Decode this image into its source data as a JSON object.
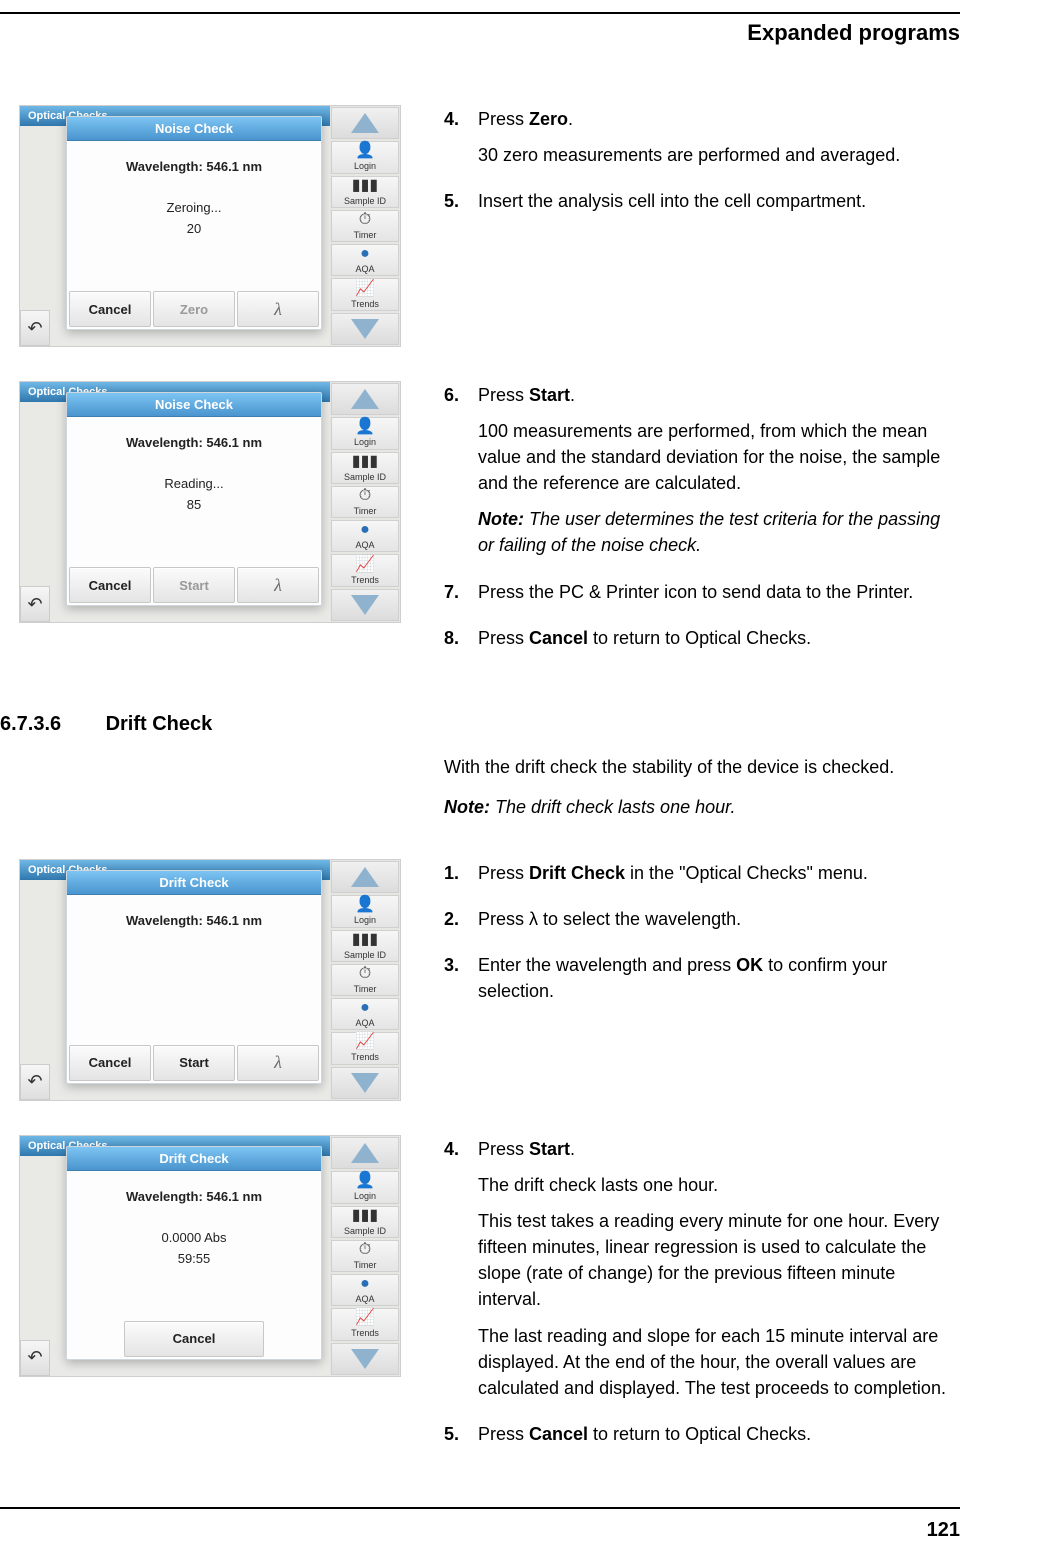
{
  "header": {
    "title": "Expanded programs"
  },
  "footer": {
    "page_number": "121"
  },
  "sidebar": {
    "login": "Login",
    "sample_id": "Sample ID",
    "timer": "Timer",
    "aqa": "AQA",
    "trends": "Trends"
  },
  "screens": {
    "noise_zeroing": {
      "app_header": "Optical Checks",
      "title": "Noise Check",
      "wavelength": "Wavelength: 546.1 nm",
      "status": "Zeroing...",
      "count": "20",
      "btn_cancel": "Cancel",
      "btn_zero": "Zero"
    },
    "noise_reading": {
      "app_header": "Optical Checks",
      "title": "Noise Check",
      "wavelength": "Wavelength: 546.1 nm",
      "status": "Reading...",
      "count": "85",
      "btn_cancel": "Cancel",
      "btn_start": "Start"
    },
    "drift_start": {
      "app_header": "Optical Checks",
      "title": "Drift Check",
      "wavelength": "Wavelength: 546.1 nm",
      "btn_cancel": "Cancel",
      "btn_start": "Start"
    },
    "drift_running": {
      "app_header": "Optical Checks",
      "title": "Drift Check",
      "wavelength": "Wavelength: 546.1 nm",
      "abs": "0.0000 Abs",
      "time": "59:55",
      "btn_cancel": "Cancel"
    }
  },
  "section": {
    "number": "6.7.3.6",
    "title": "Drift Check"
  },
  "block1": {
    "s4": {
      "num": "4.",
      "text_a": "Press ",
      "bold_a": "Zero",
      "text_b": ".",
      "line2": "30 zero measurements are performed and averaged."
    },
    "s5": {
      "num": "5.",
      "line1": "Insert the analysis cell into the cell compartment."
    }
  },
  "block2": {
    "s6": {
      "num": "6.",
      "text_a": "Press ",
      "bold_a": "Start",
      "text_b": ".",
      "line2": "100 measurements are performed, from which the mean value and the standard deviation for the noise, the sample and the reference are calculated.",
      "note_label": "Note:",
      "note": " The user determines the test criteria for the passing or failing of the noise check."
    },
    "s7": {
      "num": "7.",
      "line1": "Press the PC & Printer icon to send data to the Printer."
    },
    "s8": {
      "num": "8.",
      "text_a": "Press ",
      "bold_a": "Cancel",
      "text_b": " to return to Optical Checks."
    }
  },
  "block3_intro": {
    "line1": "With the drift check the stability of the device is checked.",
    "note_label": "Note:",
    "note": " The drift check lasts one hour."
  },
  "block3": {
    "s1": {
      "num": "1.",
      "text_a": "Press ",
      "bold_a": "Drift Check",
      "text_b": " in the \"Optical Checks\" menu."
    },
    "s2": {
      "num": "2.",
      "line1": "Press λ to select the wavelength."
    },
    "s3": {
      "num": "3.",
      "text_a": "Enter the wavelength and press ",
      "bold_a": "OK",
      "text_b": " to confirm your selection."
    }
  },
  "block4": {
    "s4": {
      "num": "4.",
      "text_a": "Press ",
      "bold_a": "Start",
      "text_b": ".",
      "line2": "The drift check lasts one hour.",
      "line3": "This test takes a reading every minute for one hour. Every fifteen minutes, linear regression is used to calculate the slope (rate of change) for the previous fifteen minute interval.",
      "line4": "The last reading and slope for each 15 minute interval are displayed. At the end of the hour, the overall values are calculated and displayed. The test proceeds to completion."
    },
    "s5": {
      "num": "5.",
      "text_a": "Press ",
      "bold_a": "Cancel",
      "text_b": " to return to Optical Checks."
    }
  }
}
